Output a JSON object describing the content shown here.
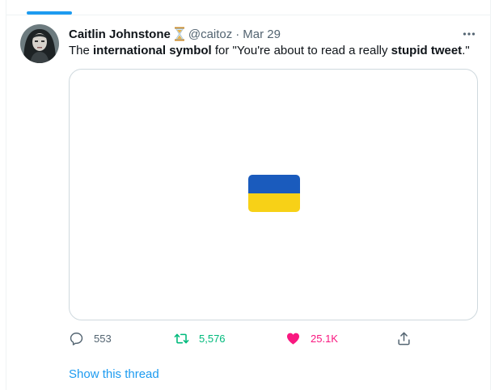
{
  "tweet": {
    "author_name": "Caitlin Johnstone",
    "badge_icon": "hourglass-icon",
    "handle": "@caitoz",
    "separator": "·",
    "date": "Mar 29",
    "more_icon": "more-icon",
    "text_parts": [
      "The ",
      "international symbol",
      " for \"You're about to read a really ",
      "stupid tweet",
      ".\""
    ],
    "media_icon": "ukraine-flag",
    "colors": {
      "flag_blue": "#1a5bbd",
      "flag_yellow": "#f7d117",
      "accent": "#1d9bf0",
      "retweet": "#00ba7c",
      "like": "#f91880"
    }
  },
  "actions": {
    "reply_count": "553",
    "retweet_count": "5,576",
    "like_count": "25.1K",
    "reply_icon": "reply-icon",
    "retweet_icon": "retweet-icon",
    "like_icon": "heart-icon",
    "share_icon": "share-icon"
  },
  "show_thread_label": "Show this thread"
}
